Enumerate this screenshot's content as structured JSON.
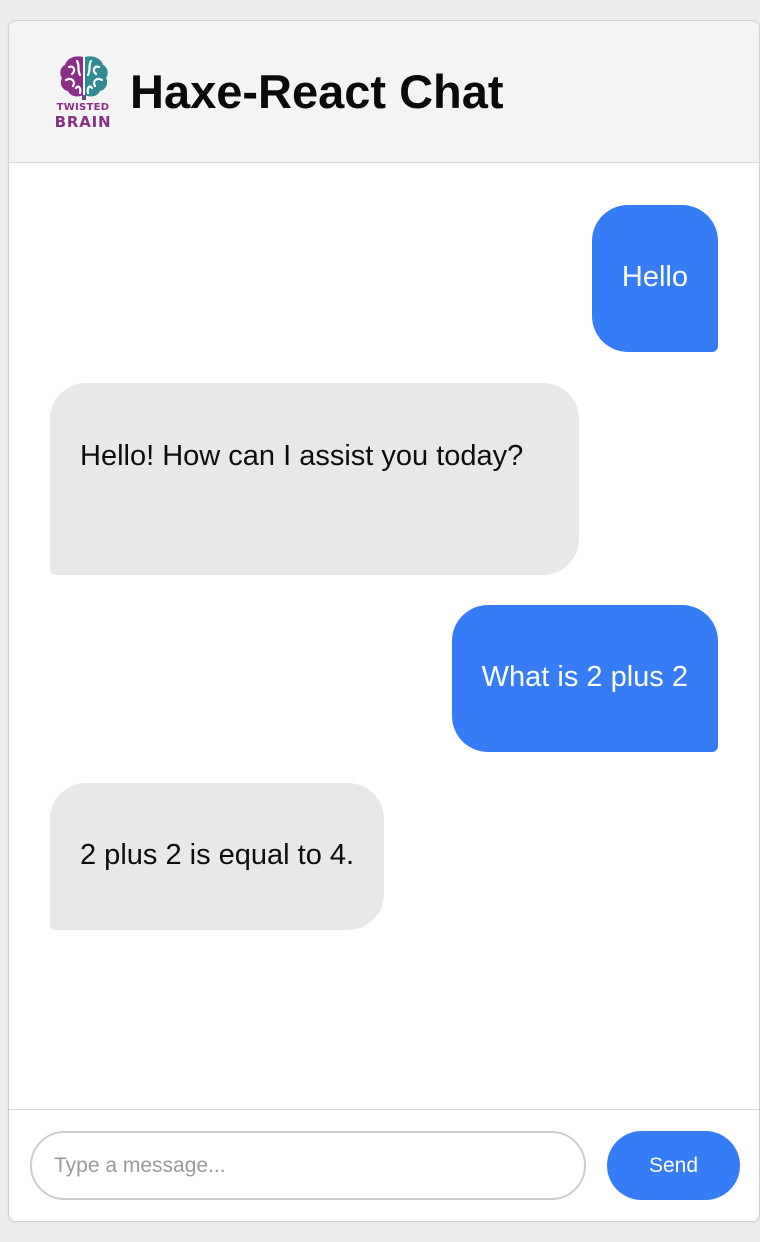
{
  "header": {
    "title": "Haxe-React Chat",
    "logo": {
      "line1": "TWISTED",
      "line2": "BRAIN",
      "icon": "brain-icon"
    }
  },
  "messages": [
    {
      "role": "user",
      "text": "Hello"
    },
    {
      "role": "assistant",
      "text": "Hello! How can I assist you today?"
    },
    {
      "role": "user",
      "text": "What is 2 plus 2"
    },
    {
      "role": "assistant",
      "text": "2 plus 2 is equal to 4."
    }
  ],
  "composer": {
    "placeholder": "Type a message...",
    "value": "",
    "send_label": "Send"
  },
  "colors": {
    "accent": "#367cf6",
    "assistant_bubble": "#e8e8ea",
    "header_bg": "#f4f4f4",
    "logo_purple": "#8a2f86",
    "logo_teal": "#2f8a94"
  }
}
